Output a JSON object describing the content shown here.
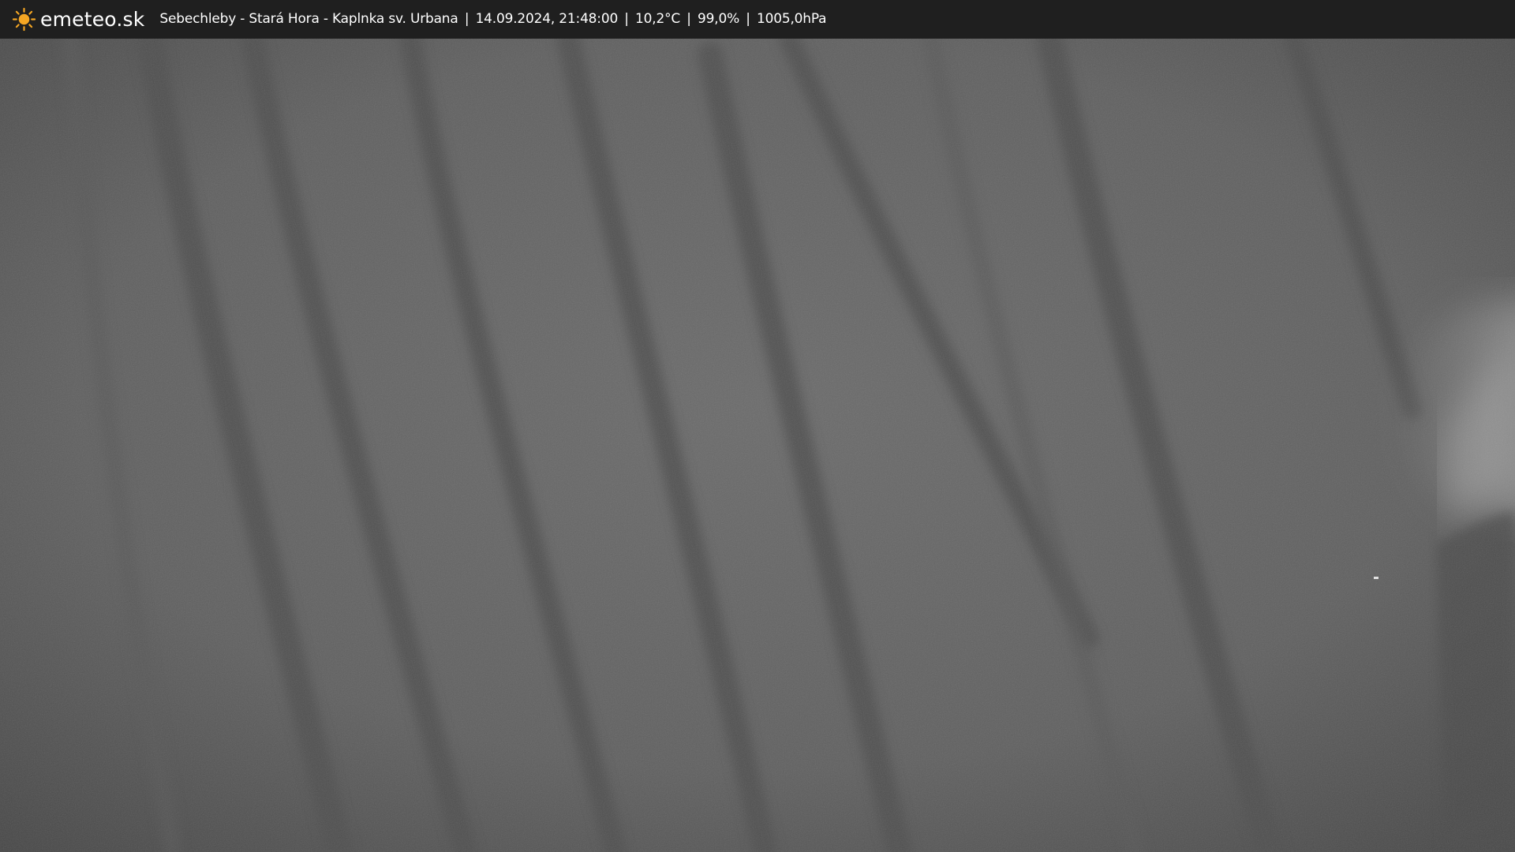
{
  "brand": {
    "name": "emeteo.sk",
    "icon": "sun-icon",
    "accent": "#f5a623"
  },
  "caption": {
    "location": "Sebechleby - Stará Hora - Kaplnka sv. Urbana",
    "datetime": "14.09.2024, 21:48:00",
    "temperature": "10,2°C",
    "humidity": "99,0%",
    "pressure": "1005,0hPa",
    "separator": "|"
  },
  "colors": {
    "bar_background": "#1f1f1f",
    "text": "#ffffff",
    "scene_base": "#5e5e5e"
  }
}
